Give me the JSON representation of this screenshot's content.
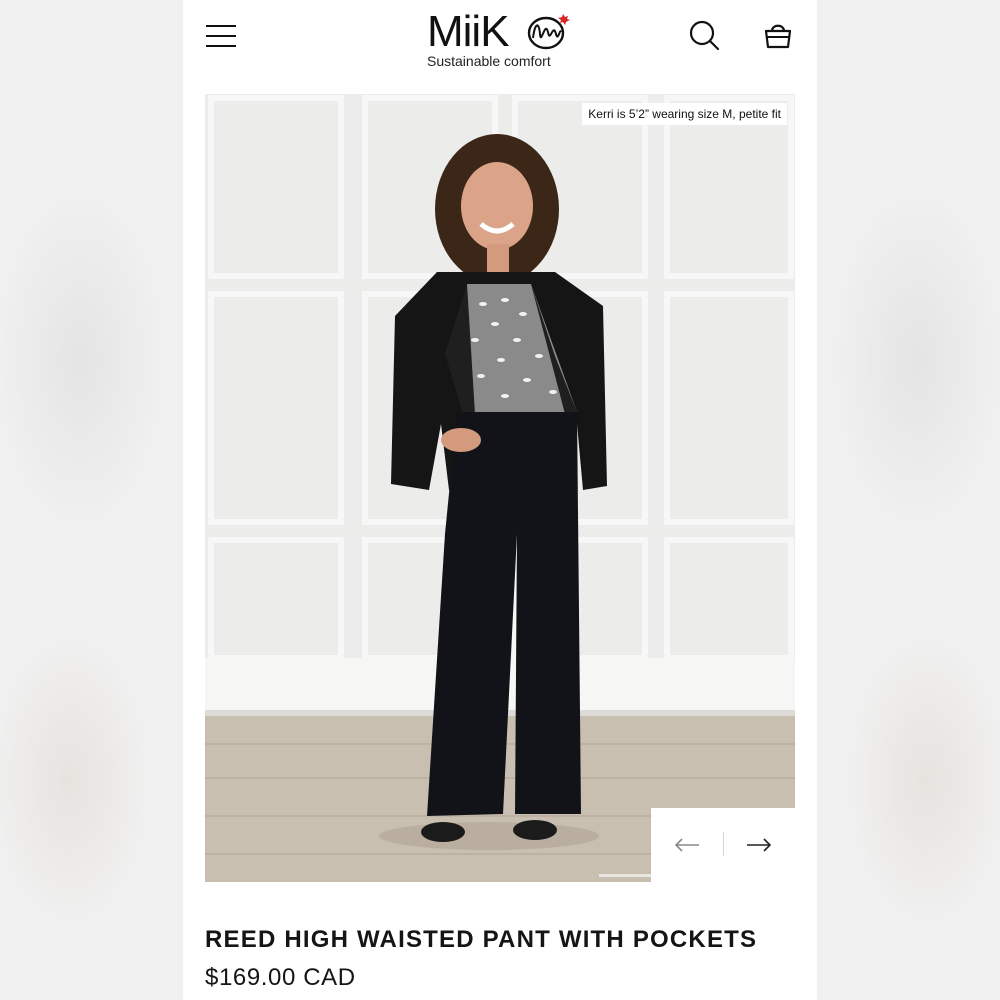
{
  "brand": {
    "name": "MiiK",
    "tagline": "Sustainable comfort"
  },
  "header": {
    "menu_icon": "hamburger-menu-icon",
    "search_icon": "search-icon",
    "cart_icon": "shopping-bag-icon"
  },
  "gallery": {
    "caption": "Kerri is 5’2” wearing size M, petite fit",
    "prev_icon": "arrow-left-icon",
    "next_icon": "arrow-right-icon"
  },
  "product": {
    "title": "REED HIGH WAISTED PANT WITH POCKETS",
    "price": "$169.00 CAD"
  },
  "colors": {
    "text": "#151515",
    "background": "#ffffff",
    "logo_leaf": "#d62828"
  }
}
